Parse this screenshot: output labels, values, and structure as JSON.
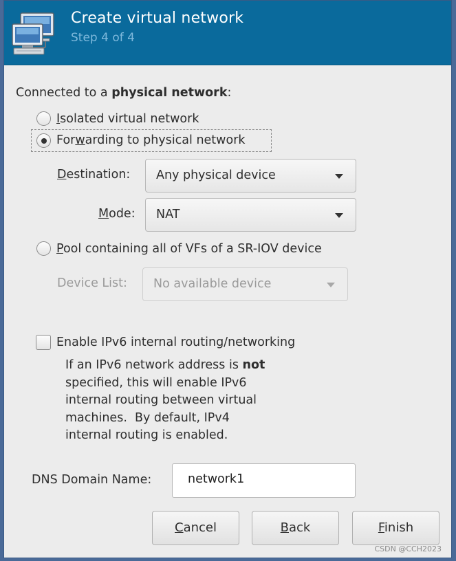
{
  "header": {
    "title": "Create virtual network",
    "step": "Step 4 of 4"
  },
  "connection": {
    "intro_prefix": "Connected to a ",
    "intro_bold": "physical network",
    "intro_suffix": ":",
    "isolated": {
      "mnemonic": "I",
      "rest": "solated virtual network",
      "selected": false
    },
    "forwarding": {
      "pre": "For",
      "mnemonic": "w",
      "rest": "arding to physical network",
      "selected": true
    },
    "destination": {
      "mnemonic": "D",
      "label_rest": "estination:",
      "value": "Any physical device"
    },
    "mode": {
      "mnemonic": "M",
      "label_rest": "ode:",
      "value": "NAT"
    },
    "pool": {
      "mnemonic": "P",
      "rest": "ool containing all of VFs of a SR-IOV device",
      "selected": false
    },
    "device_list": {
      "label": "Device List:",
      "value": "No available device",
      "enabled": false
    }
  },
  "ipv6": {
    "label": "Enable IPv6 internal routing/networking",
    "checked": false,
    "help_prefix": "If an IPv6 network address is ",
    "help_bold": "not",
    "help_line2": "specified, this will enable IPv6",
    "help_line3": "internal routing between virtual",
    "help_line4": "machines.  By default, IPv4",
    "help_line5": "internal routing is enabled."
  },
  "dns": {
    "label": "DNS Domain Name:",
    "value": "network1"
  },
  "buttons": {
    "cancel": {
      "mnemonic": "C",
      "rest": "ancel"
    },
    "back": {
      "mnemonic": "B",
      "rest": "ack"
    },
    "finish": {
      "mnemonic": "F",
      "rest": "inish"
    }
  },
  "watermark": "CSDN @CCH2023",
  "colors": {
    "header_bg": "#0a6a9c",
    "step_text": "#7fb9dc",
    "window_bg": "#ececec"
  },
  "icons": {
    "header": "network-computers-icon",
    "dropdown": "triangle-down-icon"
  }
}
